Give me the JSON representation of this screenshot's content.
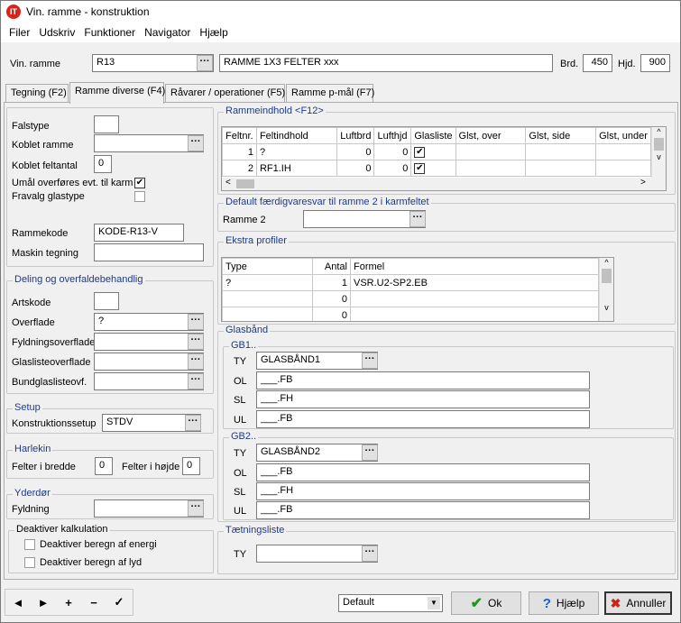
{
  "window": {
    "title": "Vin. ramme - konstruktion",
    "logo_text": "IT"
  },
  "menu": [
    "Filer",
    "Udskriv",
    "Funktioner",
    "Navigator",
    "Hjælp"
  ],
  "header": {
    "vin_ramme_label": "Vin. ramme",
    "vin_ramme_value": "R13",
    "description": "RAMME 1X3 FELTER xxx",
    "brd_label": "Brd.",
    "brd_value": "450",
    "hjd_label": "Hjd.",
    "hjd_value": "900"
  },
  "tabs": [
    "Tegning (F2)",
    "Ramme diverse (F4)",
    "Råvarer / operationer (F5)",
    "Ramme p-mål (F7)"
  ],
  "left": {
    "falstype": "Falstype",
    "koblet_ramme": "Koblet ramme",
    "koblet_feltantal": "Koblet feltantal",
    "koblet_feltantal_value": "0",
    "umaal": "Umål overføres evt. til karm",
    "fravalg": "Fravalg glastype",
    "rammekode": "Rammekode",
    "rammekode_value": "KODE-R13-V",
    "maskin": "Maskin tegning",
    "deling_title": "Deling og overfaldebehandlig",
    "artskode": "Artskode",
    "overflade": "Overflade",
    "overflade_value": "?",
    "fyldnings": "Fyldningsoverflade",
    "glasliste": "Glaslisteoverflade",
    "bundglas": "Bundglaslisteovf.",
    "setup_title": "Setup",
    "konstruktionssetup": "Konstruktionssetup",
    "konstruktionssetup_value": "STDV",
    "harlekin_title": "Harlekin",
    "felter_bredde": "Felter i bredde",
    "felter_bredde_value": "0",
    "felter_hojde": "Felter i højde",
    "felter_hojde_value": "0",
    "yderdor_title": "Yderdør",
    "fyldning": "Fyldning",
    "deaktiver_title": "Deaktiver kalkulation",
    "deaktiver_energi": "Deaktiver beregn af energi",
    "deaktiver_lyd": "Deaktiver beregn af lyd"
  },
  "rammeindhold": {
    "title": "Rammeindhold <F12>",
    "columns": [
      "Feltnr.",
      "Feltindhold",
      "Luftbrd",
      "Lufthjd",
      "Glasliste",
      "Glst, over",
      "Glst, side",
      "Glst, under"
    ],
    "rows": [
      [
        "1",
        "?",
        "0",
        "0"
      ],
      [
        "2",
        "RF1.IH",
        "0",
        "0"
      ]
    ]
  },
  "default_faerdig": {
    "title": "Default færdigvaresvar til ramme 2 i karmfeltet",
    "ramme2": "Ramme 2"
  },
  "ekstra": {
    "title": "Ekstra profiler",
    "columns": [
      "Type",
      "Antal",
      "Formel"
    ],
    "rows": [
      [
        "?",
        "1",
        "VSR.U2-SP2.EB"
      ],
      [
        "",
        "0",
        ""
      ],
      [
        "",
        "0",
        ""
      ]
    ]
  },
  "glasband": {
    "title": "Glasbånd",
    "gb1": {
      "title": "GB1..",
      "ty": "TY",
      "ty_value": "GLASBÅND1",
      "ol": "OL",
      "ol_value": "___.FB",
      "sl": "SL",
      "sl_value": "___.FH",
      "ul": "UL",
      "ul_value": "___.FB"
    },
    "gb2": {
      "title": "GB2..",
      "ty": "TY",
      "ty_value": "GLASBÅND2",
      "ol": "OL",
      "ol_value": "___.FB",
      "sl": "SL",
      "sl_value": "___.FH",
      "ul": "UL",
      "ul_value": "___.FB"
    }
  },
  "taetning": {
    "title": "Tætningsliste",
    "ty": "TY"
  },
  "bottom": {
    "nav": [
      "◄",
      "►",
      "+",
      "−",
      "✓"
    ],
    "select": "Default",
    "ok": "Ok",
    "help": "Hjælp",
    "cancel": "Annuller"
  }
}
